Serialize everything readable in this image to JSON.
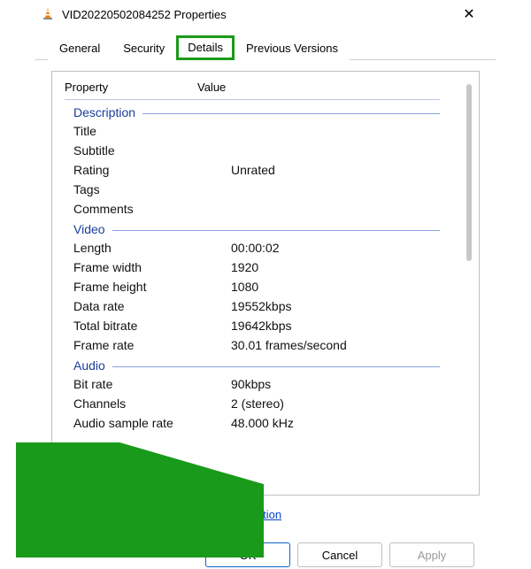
{
  "window": {
    "title": "VID20220502084252 Properties",
    "close_icon": "✕"
  },
  "tabs": {
    "items": [
      {
        "label": "General"
      },
      {
        "label": "Security"
      },
      {
        "label": "Details"
      },
      {
        "label": "Previous Versions"
      }
    ],
    "active_index": 2
  },
  "details": {
    "header_property": "Property",
    "header_value": "Value",
    "groups": [
      {
        "name": "Description",
        "rows": [
          {
            "name": "Title",
            "value": ""
          },
          {
            "name": "Subtitle",
            "value": ""
          },
          {
            "name": "Rating",
            "value": "Unrated"
          },
          {
            "name": "Tags",
            "value": ""
          },
          {
            "name": "Comments",
            "value": ""
          }
        ]
      },
      {
        "name": "Video",
        "rows": [
          {
            "name": "Length",
            "value": "00:00:02"
          },
          {
            "name": "Frame width",
            "value": "1920"
          },
          {
            "name": "Frame height",
            "value": "1080"
          },
          {
            "name": "Data rate",
            "value": "19552kbps"
          },
          {
            "name": "Total bitrate",
            "value": "19642kbps"
          },
          {
            "name": "Frame rate",
            "value": "30.01 frames/second"
          }
        ]
      },
      {
        "name": "Audio",
        "rows": [
          {
            "name": "Bit rate",
            "value": "90kbps"
          },
          {
            "name": "Channels",
            "value": "2 (stereo)"
          },
          {
            "name": "Audio sample rate",
            "value": "48.000 kHz"
          }
        ]
      }
    ]
  },
  "link": {
    "label": "Remove Properties and Personal Information"
  },
  "buttons": {
    "ok": "OK",
    "cancel": "Cancel",
    "apply": "Apply"
  },
  "annotations": {
    "details_tab_highlight_color": "#1a9a1a",
    "arrow_color": "#1a9a1a"
  }
}
